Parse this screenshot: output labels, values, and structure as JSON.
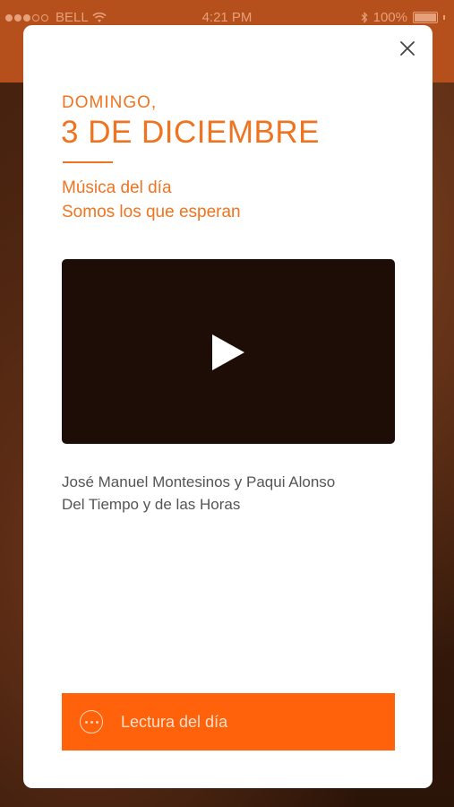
{
  "status_bar": {
    "carrier": "BELL",
    "time": "4:21 PM",
    "battery": "100%"
  },
  "modal": {
    "day": "DOMINGO,",
    "date": "3 DE DICIEMBRE",
    "section_title": "Música del día",
    "song_title": "Somos los que esperan",
    "artist": "José Manuel Montesinos y Paqui Alonso",
    "album": "Del Tiempo y de las Horas",
    "reading_button_label": "Lectura del día"
  },
  "colors": {
    "accent": "#f07420",
    "button": "#ff620a",
    "video_bg": "#1d0d06"
  },
  "icons": {
    "close": "close-icon",
    "play": "play-icon",
    "reading": "more-circle-icon"
  }
}
